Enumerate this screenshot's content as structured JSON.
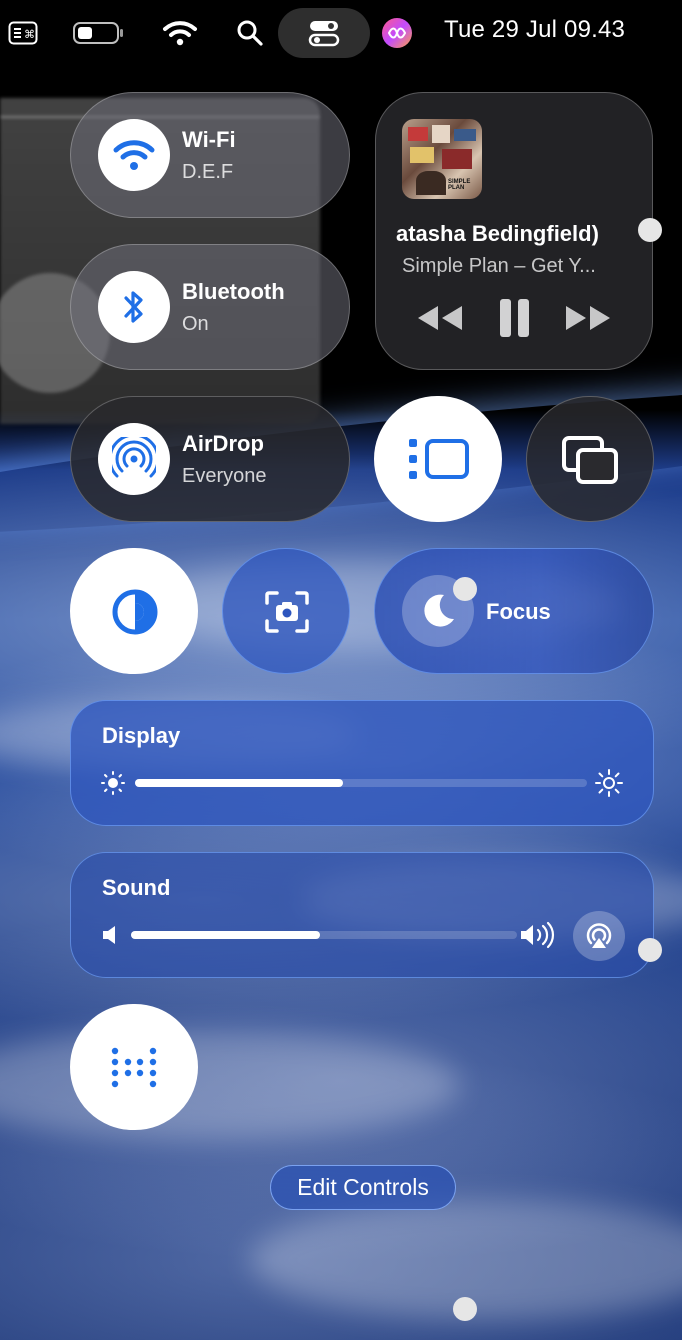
{
  "menubar": {
    "datetime": "Tue 29 Jul 09.43",
    "icons": [
      "keyboard-shortcut-icon",
      "battery-icon",
      "wifi-icon",
      "search-icon",
      "control-center-icon",
      "siri-icon"
    ]
  },
  "controls": {
    "wifi": {
      "title": "Wi-Fi",
      "subtitle": "D.E.F"
    },
    "bluetooth": {
      "title": "Bluetooth",
      "subtitle": "On"
    },
    "airdrop": {
      "title": "AirDrop",
      "subtitle": "Everyone"
    },
    "now_playing": {
      "title": "atasha Bedingfield)",
      "subtitle": "Simple Plan – Get Y...",
      "album_art_text": "SIMPLE PLAN"
    },
    "focus": {
      "label": "Focus"
    },
    "display": {
      "label": "Display",
      "brightness_fraction": 0.46
    },
    "sound": {
      "label": "Sound",
      "volume_fraction": 0.49
    }
  },
  "edit_controls_label": "Edit Controls",
  "colors": {
    "accent_blue": "#1f6fe6",
    "tile_gray": "#6e6e78",
    "focus_blue": "#2d55be"
  }
}
